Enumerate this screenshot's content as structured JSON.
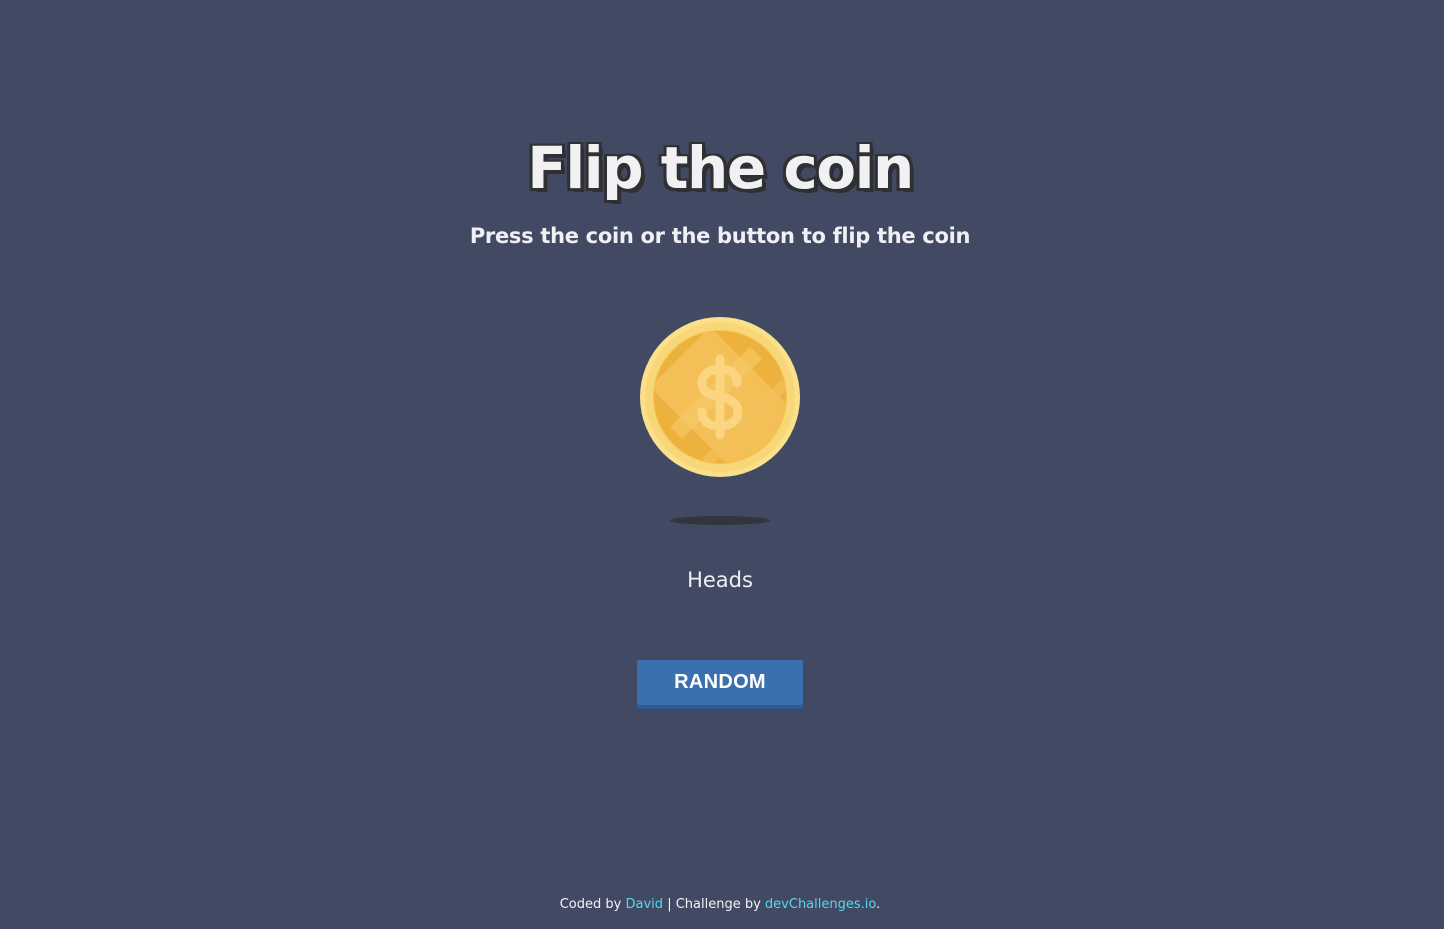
{
  "header": {
    "title": "Flip the coin",
    "subtitle": "Press the coin or the button to flip the coin"
  },
  "coin": {
    "icon": "dollar-coin-icon",
    "colors": {
      "rim": "#fbe08b",
      "face": "#edb23e",
      "face_light": "#f4c05a",
      "symbol": "#fbd580"
    },
    "shadow_color": "#2f3134"
  },
  "result": {
    "text": "Heads"
  },
  "controls": {
    "random_label": "RANDOM",
    "button_color": "#3b6fad"
  },
  "footer": {
    "coded_by_prefix": "Coded by",
    "author": "David",
    "separator": "| Challenge by",
    "challenge_site": "devChallenges.io",
    "suffix": ".",
    "link_color": "#55d7ef"
  },
  "theme": {
    "background": "#424a63",
    "text": "#f0f0f4"
  }
}
